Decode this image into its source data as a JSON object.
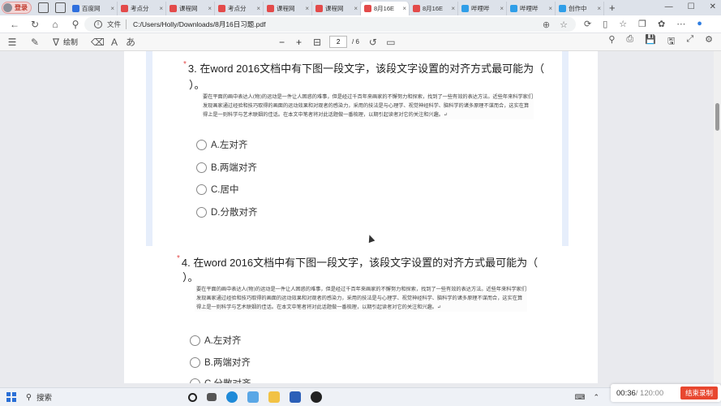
{
  "browser": {
    "login_label": "登录",
    "tabs": [
      {
        "label": "百度网",
        "color": "#2f6fde",
        "active": false
      },
      {
        "label": "考点分",
        "color": "#e34a4a",
        "active": false
      },
      {
        "label": "课程网",
        "color": "#e34a4a",
        "active": false
      },
      {
        "label": "考点分",
        "color": "#e34a4a",
        "active": false
      },
      {
        "label": "课程网",
        "color": "#e34a4a",
        "active": false
      },
      {
        "label": "课程网",
        "color": "#e34a4a",
        "active": false
      },
      {
        "label": "8月16E",
        "color": "#e34a4a",
        "active": true
      },
      {
        "label": "8月16E",
        "color": "#e34a4a",
        "active": false
      },
      {
        "label": "哔哩哔",
        "color": "#2f9ee8",
        "active": false
      },
      {
        "label": "哔哩哔",
        "color": "#2f9ee8",
        "active": false
      },
      {
        "label": "创作中",
        "color": "#2f9ee8",
        "active": false
      }
    ],
    "new_tab": "+",
    "address_label": "文件",
    "url": "C:/Users/Holly/Downloads/8月16日习题.pdf"
  },
  "pdf_toolbar": {
    "draw_label": "绘制",
    "current_page": "2",
    "total_pages": "/ 6",
    "zoom_out": "−",
    "zoom_in": "+"
  },
  "questions": [
    {
      "number_title": "3. 在word 2016文档中有下图一段文字，该段文字设置的对齐方式最可能为（",
      "title_cont": "）。",
      "passage": "要在平面的画中表达人(物)的运动是一件让人困惑的难事，但是经过千百年来画家的不懈努力和探索，找到了一些有效的表达方法。近些年来科学家们发现画家通过经验和技巧取得的画面的运动效果和对观者的感染力，采用的技法是与心理学、视觉神经科学、脑科学的诸多原理不谋而合，这实在算得上是一则科学与艺术联姻的佳话。在本文中笔者将对此话题做一番梳理，以期引起读者对它的关注和兴趣。↵",
      "options": [
        "A.左对齐",
        "B.两端对齐",
        "C.居中",
        "D.分散对齐"
      ]
    },
    {
      "number_title": "4. 在word 2016文档中有下图一段文字，该段文字设置的对齐方式最可能为（",
      "title_cont": "）。",
      "passage": "要在平面的画中表达人(物)的运动是一件让人困惑的难事，但是经过千百年来画家的不懈努力和探索，找到了一些有效的表达方法。近些年来科学家们发现画家通过经验和技巧取得的画面的运动效果和对观者的感染力，采用的技法是与心理学、视觉神经科学、脑科学的诸多原理不谋而合，这实在算得上是一则科学与艺术联姻的佳话。在本文中笔者将对此话题做一番梳理，以期引起读者对它的关注和兴趣。↵",
      "options": [
        "A.左对齐",
        "B.两端对齐",
        "C.分散对齐"
      ]
    }
  ],
  "taskbar": {
    "search_label": "搜索"
  },
  "recorder": {
    "elapsed": "00:36",
    "total": " / 120:00",
    "stop_label": "结束录制"
  }
}
